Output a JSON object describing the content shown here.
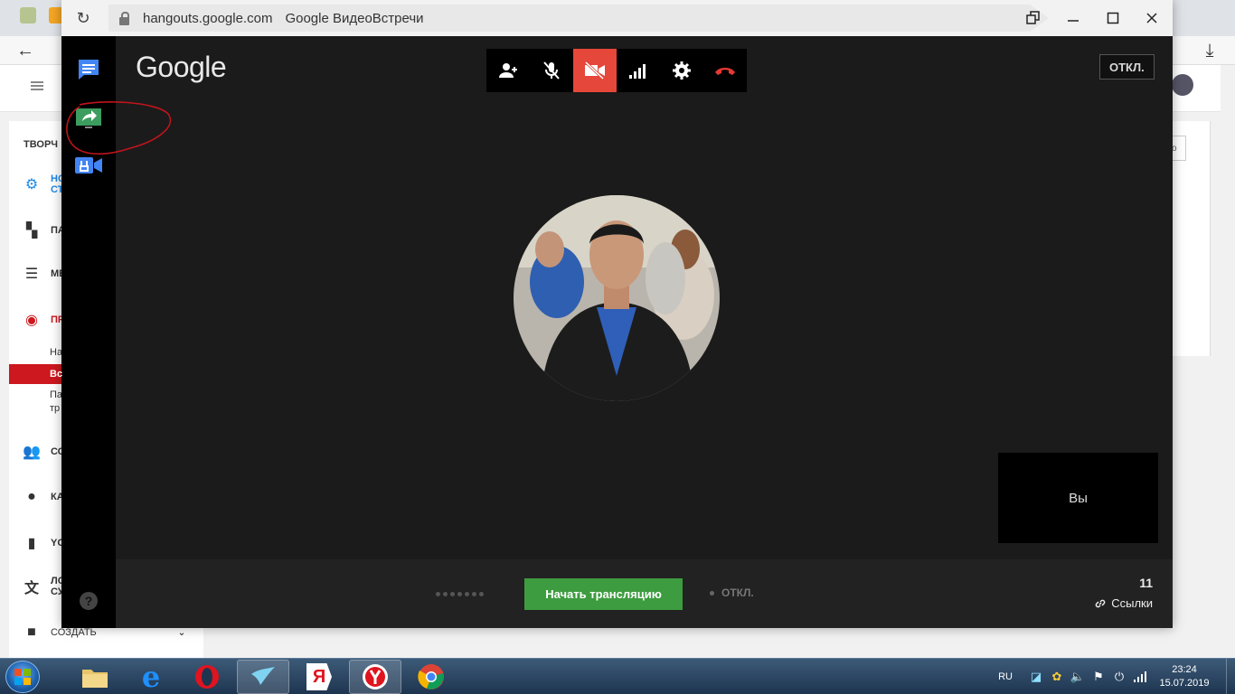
{
  "background_browser": {
    "youtube_sidebar": {
      "section_heading": "ТВОРЧ",
      "items": [
        {
          "label": "НО\nСТ",
          "icon": "gear-icon"
        },
        {
          "label": "ПА",
          "icon": "dashboard-icon"
        },
        {
          "label": "МЕ",
          "icon": "video-manager-icon"
        },
        {
          "label": "ПР",
          "icon": "live-icon"
        },
        {
          "label": "СО",
          "icon": "community-icon"
        },
        {
          "label": "КА",
          "icon": "channel-icon"
        },
        {
          "label": "YO",
          "icon": "analytics-icon"
        },
        {
          "label": "ЛО\nСУ",
          "icon": "translate-icon"
        },
        {
          "label": "СОЗДАТЬ",
          "icon": "create-icon"
        }
      ],
      "sub_items": [
        "На",
        "Вс",
        "Па",
        "тр"
      ],
      "card_button_text": "о"
    }
  },
  "popup": {
    "address": {
      "url": "hangouts.google.com",
      "page_title": "Google ВидеоВстречи"
    },
    "window_controls": {
      "restore_icon": "restore-icon",
      "minimize_icon": "minimize-icon",
      "maximize_icon": "maximize-icon",
      "close_icon": "close-icon"
    },
    "logo_text": "Google",
    "left_rail": [
      "chat-icon",
      "screenshare-icon",
      "video-tools-icon"
    ],
    "help_label": "?",
    "toolbar": [
      "add-person-icon",
      "mic-off-icon",
      "camera-off-icon",
      "signal-icon",
      "settings-icon",
      "hang-up-icon"
    ],
    "top_status": "ОТКЛ.",
    "self_view_label": "Вы",
    "bottom": {
      "start_broadcast": "Начать трансляцию",
      "broadcast_status": "ОТКЛ.",
      "viewer_count": "11",
      "links_label": "Ссылки"
    },
    "accent_colors": {
      "active_tool": "#e5473a",
      "start_button": "#3d9c3f",
      "hang_up": "#e53935"
    }
  },
  "taskbar": {
    "apps": [
      "file-explorer-icon",
      "internet-explorer-icon",
      "opera-icon",
      "hummingbird-app-icon",
      "yandex-letter-icon",
      "yandex-browser-icon",
      "chrome-icon"
    ],
    "language": "RU",
    "time": "23:24",
    "date": "15.07.2019"
  }
}
